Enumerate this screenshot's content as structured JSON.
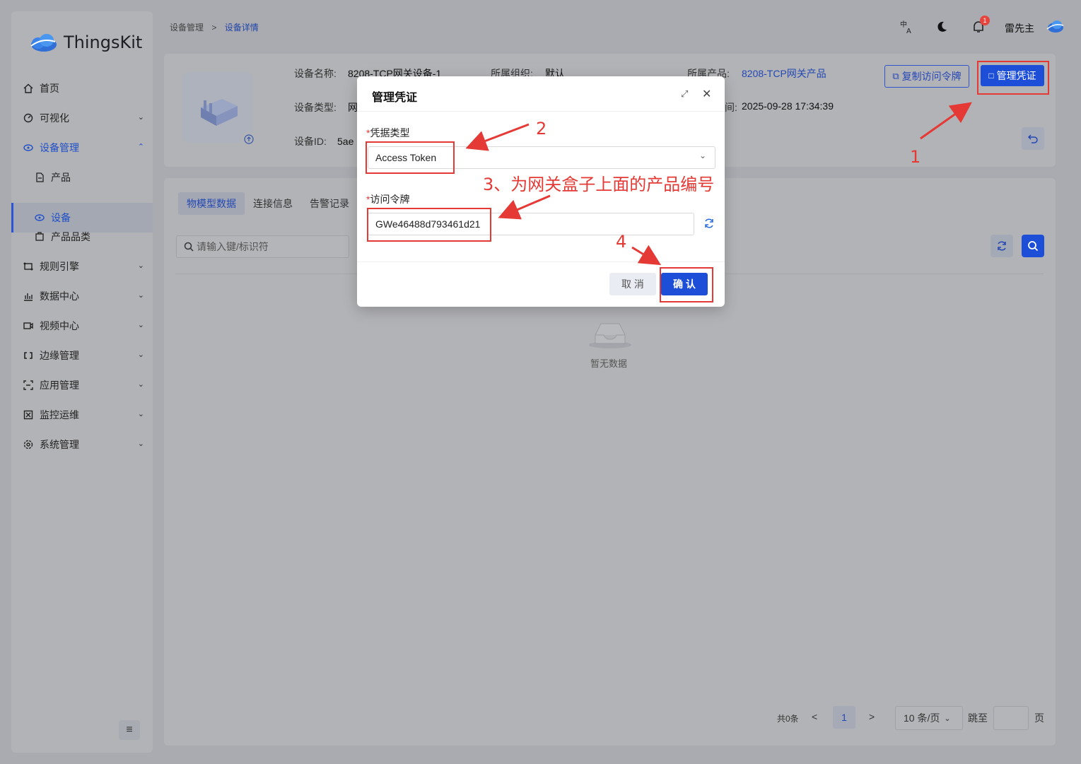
{
  "app": {
    "logo_text": "ThingsKit"
  },
  "sidebar": {
    "items": [
      {
        "label": "首页",
        "icon": "home-icon"
      },
      {
        "label": "可视化",
        "icon": "dashboard-icon"
      },
      {
        "label": "设备管理",
        "icon": "device-icon"
      },
      {
        "label": "产品",
        "icon": "file-icon"
      },
      {
        "label": "设备",
        "icon": "device-icon"
      },
      {
        "label": "产品品类",
        "icon": "category-icon"
      },
      {
        "label": "规则引擎",
        "icon": "rule-icon"
      },
      {
        "label": "数据中心",
        "icon": "chart-icon"
      },
      {
        "label": "视频中心",
        "icon": "video-icon"
      },
      {
        "label": "边缘管理",
        "icon": "edge-icon"
      },
      {
        "label": "应用管理",
        "icon": "app-icon"
      },
      {
        "label": "监控运维",
        "icon": "monitor-icon"
      },
      {
        "label": "系统管理",
        "icon": "settings-icon"
      }
    ]
  },
  "header": {
    "breadcrumb": [
      "设备管理",
      "设备详情"
    ],
    "user_name": "雷先主",
    "notification_count": "1",
    "lang_icon": "translate-icon",
    "theme_icon": "moon-icon"
  },
  "device": {
    "name_label": "设备名称:",
    "name_value": "8208-TCP网关设备-1",
    "org_label": "所属组织:",
    "org_value": "默认",
    "product_label": "所属产品:",
    "product_value": "8208-TCP网关产品",
    "type_label": "设备类型:",
    "type_value": "网",
    "created_value": "2025-09-28 17:34:39",
    "created_label_tail": "间:",
    "id_label": "设备ID:",
    "id_value": "5ae",
    "copy_token_label": "复制访问令牌",
    "manage_cred_label": "管理凭证"
  },
  "tabs": [
    "物模型数据",
    "连接信息",
    "告警记录"
  ],
  "search": {
    "placeholder": "请输入键/标识符"
  },
  "empty_text": "暂无数据",
  "pagination": {
    "total": "共0条",
    "current": "1",
    "page_size": "10 条/页",
    "goto_label": "跳至",
    "page_label": "页"
  },
  "modal": {
    "title": "管理凭证",
    "cred_type_label": "凭据类型",
    "cred_type_value": "Access Token",
    "token_label": "访问令牌",
    "token_value": "GWe46488d793461d21",
    "cancel_label": "取 消",
    "confirm_label": "确 认"
  },
  "annotations": {
    "n1": "1",
    "n2": "2",
    "n3": "3、为网关盒子上面的产品编号",
    "n4": "4"
  },
  "colors": {
    "primary": "#1c4ed8",
    "annotation": "#e53935"
  }
}
